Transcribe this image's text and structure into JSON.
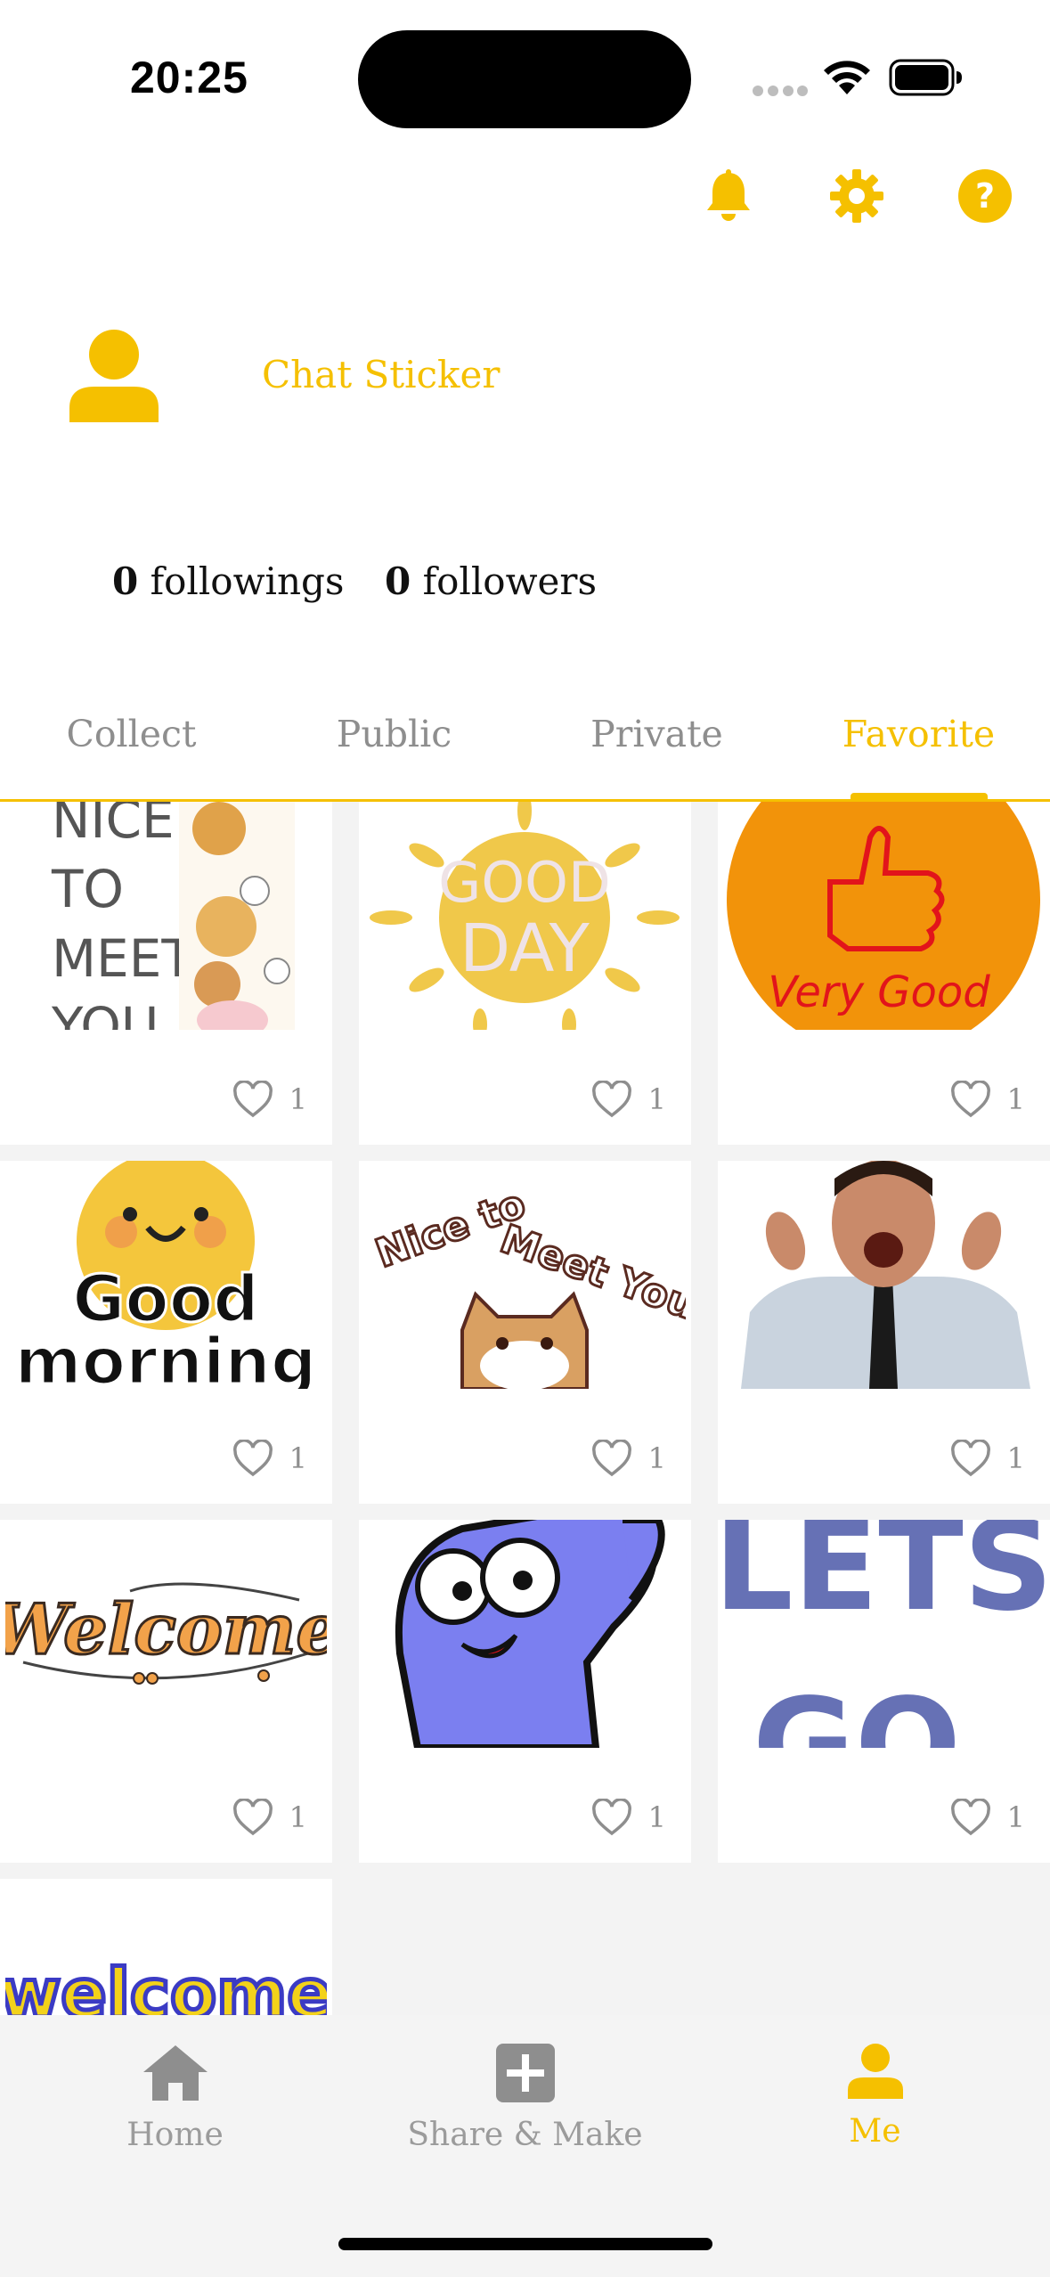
{
  "status_bar": {
    "time": "20:25"
  },
  "top_icons": [
    "bell-icon",
    "gear-icon",
    "help-icon"
  ],
  "profile": {
    "username": "Chat Sticker",
    "followings_count": "0",
    "followings_label": "followings",
    "followers_count": "0",
    "followers_label": "followers"
  },
  "tabs": [
    {
      "label": "Collect"
    },
    {
      "label": "Public"
    },
    {
      "label": "Private"
    },
    {
      "label": "Favorite"
    }
  ],
  "active_tab": "Favorite",
  "stickers": [
    {
      "name": "NICE TO MEET YOU",
      "likes": "1"
    },
    {
      "name": "GOOD DAY",
      "likes": "1"
    },
    {
      "name": "Very Good",
      "likes": "1"
    },
    {
      "name": "Good morning",
      "likes": "1"
    },
    {
      "name": "Nice to Meet You",
      "likes": "1"
    },
    {
      "name": "excited man",
      "likes": "1"
    },
    {
      "name": "Welcome",
      "likes": "1"
    },
    {
      "name": "waving blue character",
      "likes": "1"
    },
    {
      "name": "LETS GO",
      "likes": "1"
    },
    {
      "name": "welcome",
      "likes": ""
    }
  ],
  "bottom_nav": [
    {
      "label": "Home",
      "icon": "home-icon"
    },
    {
      "label": "Share & Make",
      "icon": "plus-square-icon"
    },
    {
      "label": "Me",
      "icon": "person-icon"
    }
  ],
  "colors": {
    "accent": "#F5C000",
    "inactive": "#8e8e8e",
    "grid_background": "#f3f3f3"
  }
}
